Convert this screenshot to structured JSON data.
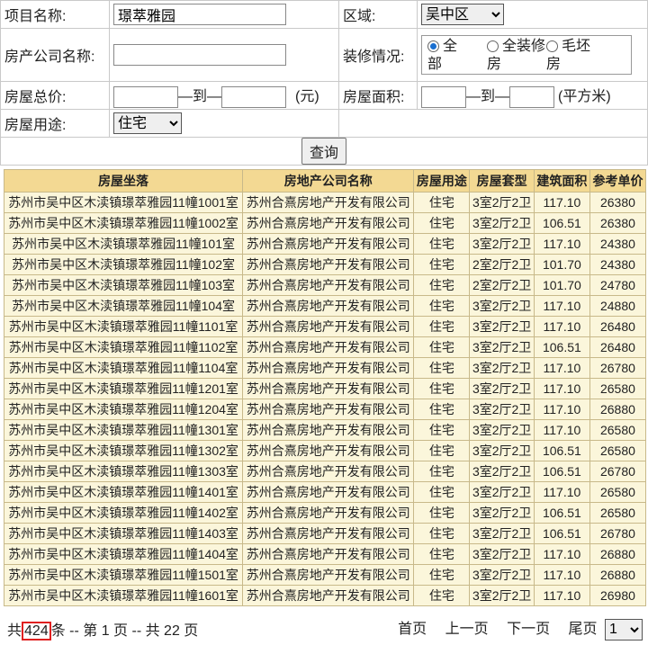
{
  "form": {
    "project_label": "项目名称:",
    "project_value": "璟萃雅园",
    "region_label": "区域:",
    "region_value": "吴中区",
    "company_label": "房产公司名称:",
    "company_value": "",
    "decor_label": "装修情况:",
    "decor_options": [
      {
        "line1": "全",
        "line2": "部",
        "selected": true
      },
      {
        "line1": "全装修",
        "line2": "房",
        "selected": false
      },
      {
        "line1": "毛坯",
        "line2": "房",
        "selected": false
      }
    ],
    "price_label": "房屋总价:",
    "to_label": "—到—",
    "price_unit": "(元)",
    "area_label": "房屋面积:",
    "area_unit": "(平方米)",
    "usage_label": "房屋用途:",
    "usage_value": "住宅",
    "query_button": "查询"
  },
  "table": {
    "headers": [
      "房屋坐落",
      "房地产公司名称",
      "房屋用途",
      "房屋套型",
      "建筑面积",
      "参考单价"
    ],
    "rows": [
      [
        "苏州市吴中区木渎镇璟萃雅园11幢1001室",
        "苏州合熹房地产开发有限公司",
        "住宅",
        "3室2厅2卫",
        "117.10",
        "26380"
      ],
      [
        "苏州市吴中区木渎镇璟萃雅园11幢1002室",
        "苏州合熹房地产开发有限公司",
        "住宅",
        "3室2厅2卫",
        "106.51",
        "26380"
      ],
      [
        "苏州市吴中区木渎镇璟萃雅园11幢101室",
        "苏州合熹房地产开发有限公司",
        "住宅",
        "3室2厅2卫",
        "117.10",
        "24380"
      ],
      [
        "苏州市吴中区木渎镇璟萃雅园11幢102室",
        "苏州合熹房地产开发有限公司",
        "住宅",
        "2室2厅2卫",
        "101.70",
        "24380"
      ],
      [
        "苏州市吴中区木渎镇璟萃雅园11幢103室",
        "苏州合熹房地产开发有限公司",
        "住宅",
        "2室2厅2卫",
        "101.70",
        "24780"
      ],
      [
        "苏州市吴中区木渎镇璟萃雅园11幢104室",
        "苏州合熹房地产开发有限公司",
        "住宅",
        "3室2厅2卫",
        "117.10",
        "24880"
      ],
      [
        "苏州市吴中区木渎镇璟萃雅园11幢1101室",
        "苏州合熹房地产开发有限公司",
        "住宅",
        "3室2厅2卫",
        "117.10",
        "26480"
      ],
      [
        "苏州市吴中区木渎镇璟萃雅园11幢1102室",
        "苏州合熹房地产开发有限公司",
        "住宅",
        "3室2厅2卫",
        "106.51",
        "26480"
      ],
      [
        "苏州市吴中区木渎镇璟萃雅园11幢1104室",
        "苏州合熹房地产开发有限公司",
        "住宅",
        "3室2厅2卫",
        "117.10",
        "26780"
      ],
      [
        "苏州市吴中区木渎镇璟萃雅园11幢1201室",
        "苏州合熹房地产开发有限公司",
        "住宅",
        "3室2厅2卫",
        "117.10",
        "26580"
      ],
      [
        "苏州市吴中区木渎镇璟萃雅园11幢1204室",
        "苏州合熹房地产开发有限公司",
        "住宅",
        "3室2厅2卫",
        "117.10",
        "26880"
      ],
      [
        "苏州市吴中区木渎镇璟萃雅园11幢1301室",
        "苏州合熹房地产开发有限公司",
        "住宅",
        "3室2厅2卫",
        "117.10",
        "26580"
      ],
      [
        "苏州市吴中区木渎镇璟萃雅园11幢1302室",
        "苏州合熹房地产开发有限公司",
        "住宅",
        "3室2厅2卫",
        "106.51",
        "26580"
      ],
      [
        "苏州市吴中区木渎镇璟萃雅园11幢1303室",
        "苏州合熹房地产开发有限公司",
        "住宅",
        "3室2厅2卫",
        "106.51",
        "26780"
      ],
      [
        "苏州市吴中区木渎镇璟萃雅园11幢1401室",
        "苏州合熹房地产开发有限公司",
        "住宅",
        "3室2厅2卫",
        "117.10",
        "26580"
      ],
      [
        "苏州市吴中区木渎镇璟萃雅园11幢1402室",
        "苏州合熹房地产开发有限公司",
        "住宅",
        "3室2厅2卫",
        "106.51",
        "26580"
      ],
      [
        "苏州市吴中区木渎镇璟萃雅园11幢1403室",
        "苏州合熹房地产开发有限公司",
        "住宅",
        "3室2厅2卫",
        "106.51",
        "26780"
      ],
      [
        "苏州市吴中区木渎镇璟萃雅园11幢1404室",
        "苏州合熹房地产开发有限公司",
        "住宅",
        "3室2厅2卫",
        "117.10",
        "26880"
      ],
      [
        "苏州市吴中区木渎镇璟萃雅园11幢1501室",
        "苏州合熹房地产开发有限公司",
        "住宅",
        "3室2厅2卫",
        "117.10",
        "26880"
      ],
      [
        "苏州市吴中区木渎镇璟萃雅园11幢1601室",
        "苏州合熹房地产开发有限公司",
        "住宅",
        "3室2厅2卫",
        "117.10",
        "26980"
      ]
    ]
  },
  "pager": {
    "prefix": "共",
    "total": "424",
    "mid": "条 -- 第 1 页 -- 共 22 页",
    "first": "首页",
    "prev": "上一页",
    "next": "下一页",
    "last": "尾页",
    "page_value": "1"
  }
}
